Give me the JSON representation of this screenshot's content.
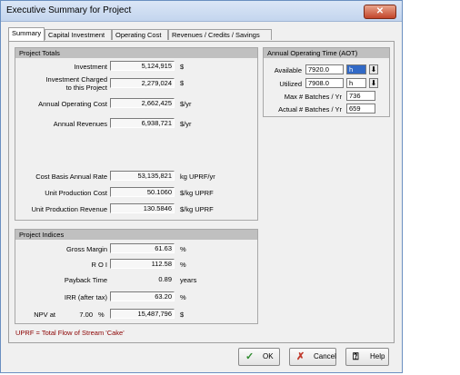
{
  "window": {
    "title": "Executive Summary for Project",
    "close_icon": "close-icon"
  },
  "tabs": [
    {
      "label": "Summary",
      "active": true
    },
    {
      "label": "Capital Investment"
    },
    {
      "label": "Operating Cost"
    },
    {
      "label": "Revenues / Credits / Savings"
    }
  ],
  "totals": {
    "header": "Project Totals",
    "investment": {
      "label": "Investment",
      "value": "5,124,915",
      "unit": "$"
    },
    "investment_charged": {
      "label1": "Investment Charged",
      "label2": "to this Project",
      "value": "2,279,024",
      "unit": "$"
    },
    "annual_operating_cost": {
      "label": "Annual Operating Cost",
      "value": "2,662,425",
      "unit": "$/yr"
    },
    "annual_revenues": {
      "label": "Annual Revenues",
      "value": "6,938,721",
      "unit": "$/yr"
    },
    "cost_basis_rate": {
      "label": "Cost Basis Annual Rate",
      "value": "53,135,821",
      "unit": "kg UPRF/yr"
    },
    "unit_production_cost": {
      "label": "Unit Production Cost",
      "value": "50.1060",
      "unit": "$/kg UPRF"
    },
    "unit_production_revenue": {
      "label": "Unit Production Revenue",
      "value": "130.5846",
      "unit": "$/kg UPRF"
    }
  },
  "aot": {
    "header": "Annual Operating Time (AOT)",
    "available": {
      "label": "Available",
      "value": "7920.0",
      "unit": "h"
    },
    "utilized": {
      "label": "Utilized",
      "value": "7908.0",
      "unit": "h"
    },
    "max_batches": {
      "label": "Max # Batches / Yr",
      "value": "736"
    },
    "actual_batches": {
      "label": "Actual # Batches / Yr",
      "value": "659"
    }
  },
  "indices": {
    "header": "Project Indices",
    "gross_margin": {
      "label": "Gross Margin",
      "value": "61.63",
      "unit": "%"
    },
    "roi": {
      "label": "R O I",
      "value": "112.58",
      "unit": "%"
    },
    "payback": {
      "label": "Payback Time",
      "value": "0.89",
      "unit": "years"
    },
    "irr": {
      "label": "IRR (after tax)",
      "value": "63.20",
      "unit": "%"
    },
    "npv": {
      "label": "NPV at",
      "rate": "7.00",
      "rate_unit": "%",
      "value": "15,487,796",
      "unit": "$"
    }
  },
  "footnote": "UPRF = Total Flow of Stream 'Cake'",
  "buttons": {
    "ok": {
      "label": "OK",
      "icon": "check-icon"
    },
    "cancel": {
      "label": "Cancel",
      "icon": "cross-icon"
    },
    "help": {
      "label": "Help",
      "icon": "help-icon"
    }
  },
  "colors": {
    "ok_icon": "#2e8b2e",
    "cancel_icon": "#c0392b",
    "footnote": "#8b0000",
    "selection": "#3169c6"
  }
}
